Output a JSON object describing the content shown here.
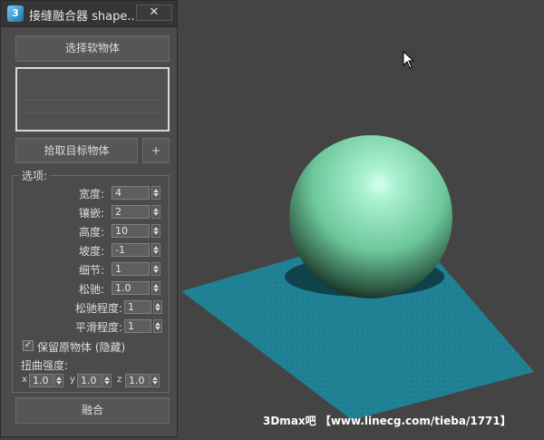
{
  "panel": {
    "title": "接缝融合器 shape...",
    "app_icon": "3",
    "close": "✕",
    "pick_soft_button": "选择软物体",
    "pick_target_button": "拾取目标物体",
    "plus_button": "+",
    "options_title": "选项:",
    "options": [
      {
        "label": "宽度:",
        "value": "4"
      },
      {
        "label": "镶嵌:",
        "value": "2"
      },
      {
        "label": "高度:",
        "value": "10"
      },
      {
        "label": "坡度:",
        "value": "-1"
      },
      {
        "label": "细节:",
        "value": "1"
      },
      {
        "label": "松驰:",
        "value": "1.0"
      },
      {
        "label": "松驰程度:",
        "value": "1"
      },
      {
        "label": "平滑程度:",
        "value": "1"
      }
    ],
    "keep_original": {
      "label": "保留原物体 (隐藏)",
      "checked": true,
      "mark": "✓"
    },
    "twist": {
      "label": "扭曲强度:",
      "axes": [
        {
          "axis": "x",
          "value": "1.0"
        },
        {
          "axis": "y",
          "value": "1.0"
        },
        {
          "axis": "z",
          "value": "1.0"
        }
      ]
    },
    "merge_button": "融合"
  },
  "viewport": {
    "watermark": "3Dmax吧 【www.linecg.com/tieba/1771】",
    "sphere_color": "#7ad6ab",
    "plane_color": "#1f7f93"
  },
  "icons": [
    "app-icon",
    "close-icon",
    "spinner-arrow-icon",
    "checkbox-check-icon",
    "mouse-cursor-icon"
  ]
}
